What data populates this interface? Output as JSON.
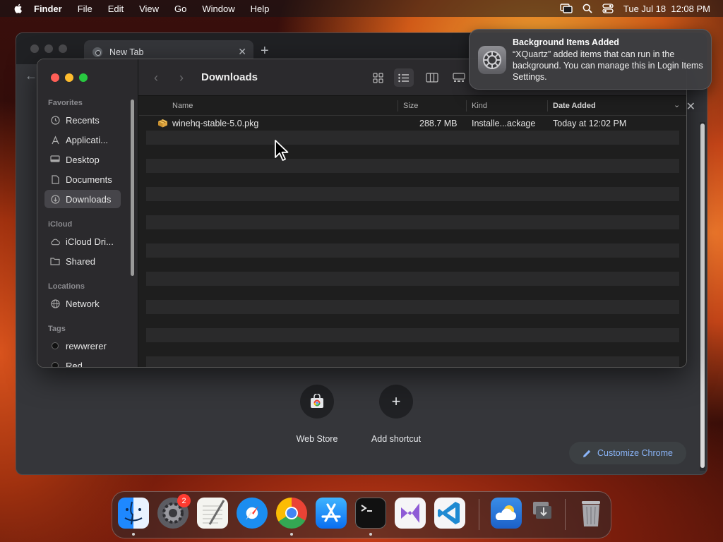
{
  "menubar": {
    "app_name": "Finder",
    "items": [
      "File",
      "Edit",
      "View",
      "Go",
      "Window",
      "Help"
    ],
    "clock": "Tue Jul 18  12:08 PM"
  },
  "chrome": {
    "tab_title": "New Tab",
    "shortcuts": [
      {
        "label": "Web Store",
        "icon": "web-store-icon"
      },
      {
        "label": "Add shortcut",
        "icon": "plus-icon"
      }
    ],
    "customize_label": "Customize Chrome"
  },
  "finder": {
    "title": "Downloads",
    "sidebar": {
      "favorites_header": "Favorites",
      "favorites": [
        {
          "label": "Recents",
          "icon": "clock-icon"
        },
        {
          "label": "Applicati...",
          "icon": "applications-icon"
        },
        {
          "label": "Desktop",
          "icon": "desktop-icon"
        },
        {
          "label": "Documents",
          "icon": "document-icon"
        },
        {
          "label": "Downloads",
          "icon": "download-icon",
          "selected": true
        }
      ],
      "icloud_header": "iCloud",
      "icloud": [
        {
          "label": "iCloud Dri...",
          "icon": "cloud-icon"
        },
        {
          "label": "Shared",
          "icon": "shared-folder-icon"
        }
      ],
      "locations_header": "Locations",
      "locations": [
        {
          "label": "Network",
          "icon": "globe-icon"
        }
      ],
      "tags_header": "Tags",
      "tags": [
        {
          "label": "rewwrerer",
          "color": "#000000"
        },
        {
          "label": "Red",
          "color": "#000000"
        }
      ]
    },
    "columns": {
      "name": "Name",
      "size": "Size",
      "kind": "Kind",
      "date_added": "Date Added"
    },
    "files": [
      {
        "name": "winehq-stable-5.0.pkg",
        "size": "288.7 MB",
        "kind": "Installe...ackage",
        "date_added": "Today at 12:02 PM",
        "icon": "package-icon"
      }
    ]
  },
  "notification": {
    "title": "Background Items Added",
    "body": "“XQuartz” added items that can run in the background. You can manage this in Login Items Settings.",
    "icon": "system-settings-icon"
  },
  "dock": {
    "apps": [
      {
        "name": "Finder",
        "icon": "finder-icon",
        "running": true
      },
      {
        "name": "System Settings",
        "icon": "system-settings-icon",
        "running": false,
        "badge": "2"
      },
      {
        "name": "TextEdit",
        "icon": "textedit-icon",
        "running": false
      },
      {
        "name": "Safari",
        "icon": "safari-icon",
        "running": false
      },
      {
        "name": "Google Chrome",
        "icon": "chrome-icon",
        "running": true
      },
      {
        "name": "App Store",
        "icon": "app-store-icon",
        "running": false
      },
      {
        "name": "Terminal",
        "icon": "terminal-icon",
        "running": true
      },
      {
        "name": "Visual Studio",
        "icon": "visual-studio-icon",
        "running": false
      },
      {
        "name": "Visual Studio Code",
        "icon": "vscode-icon",
        "running": false
      },
      {
        "name": "Weather",
        "icon": "weather-icon",
        "running": false
      },
      {
        "name": "Downloads Stack",
        "icon": "downloads-stack-icon",
        "running": false
      },
      {
        "name": "Trash",
        "icon": "trash-icon",
        "running": false
      }
    ],
    "badge_count": "2"
  },
  "colors": {
    "finder_bg": "#1e1e1e",
    "sidebar_bg": "#2b2a2d",
    "selected": "#46454a",
    "accent_link": "#8ab4f8",
    "close": "#ff5f57",
    "minimize": "#febc2e",
    "zoom": "#28c840"
  }
}
